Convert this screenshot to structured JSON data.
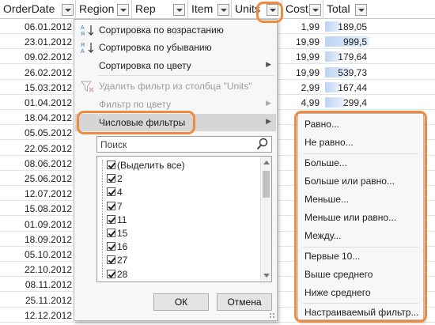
{
  "columns": [
    "OrderDate",
    "Region",
    "Rep",
    "Item",
    "Units",
    "Cost",
    "Total"
  ],
  "rows": [
    {
      "date": "06.01.2012",
      "cost": "1,99",
      "total": "189,05",
      "bar": 0.36
    },
    {
      "date": "23.01.2012",
      "cost": "19,99",
      "total": "999,5",
      "bar": 1.0
    },
    {
      "date": "09.02.2012",
      "cost": "19,99",
      "total": "179,64",
      "bar": 0.34
    },
    {
      "date": "26.02.2012",
      "cost": "19,99",
      "total": "539,73",
      "bar": 0.56
    },
    {
      "date": "15.03.2012",
      "cost": "2,99",
      "total": "167,44",
      "bar": 0.32
    },
    {
      "date": "01.04.2012",
      "cost": "4,99",
      "total": "299,4",
      "bar": 0.42
    },
    {
      "date": "18.04.2012",
      "cost": "",
      "total": "",
      "bar": 0
    },
    {
      "date": "05.05.2012",
      "cost": "",
      "total": "",
      "bar": 0
    },
    {
      "date": "22.05.2012",
      "cost": "",
      "total": "",
      "bar": 0
    },
    {
      "date": "08.06.2012",
      "cost": "",
      "total": "",
      "bar": 0
    },
    {
      "date": "25.06.2012",
      "cost": "",
      "total": "",
      "bar": 0
    },
    {
      "date": "12.07.2012",
      "cost": "",
      "total": "",
      "bar": 0
    },
    {
      "date": "15.08.2012",
      "cost": "",
      "total": "",
      "bar": 0
    },
    {
      "date": "01.09.2012",
      "cost": "",
      "total": "",
      "bar": 0
    },
    {
      "date": "18.09.2012",
      "cost": "",
      "total": "",
      "bar": 0
    },
    {
      "date": "05.10.2012",
      "cost": "",
      "total": "",
      "bar": 0
    },
    {
      "date": "22.10.2012",
      "cost": "",
      "total": "",
      "bar": 0
    },
    {
      "date": "08.11.2012",
      "cost": "",
      "total": "",
      "bar": 0
    },
    {
      "date": "25.11.2012",
      "cost": "",
      "total": "",
      "bar": 0
    },
    {
      "date": "12.12.2012",
      "cost": "",
      "total": "",
      "bar": 0
    }
  ],
  "menu": {
    "sort_asc": "Сортировка по возрастанию",
    "sort_desc": "Сортировка по убыванию",
    "sort_color": "Сортировка по цвету",
    "remove_filter": "Удалить фильтр из столбца \"Units\"",
    "filter_color": "Фильтр по цвету",
    "number_filters": "Числовые фильтры",
    "search_placeholder": "Поиск",
    "items": [
      "(Выделить все)",
      "2",
      "4",
      "7",
      "11",
      "15",
      "16",
      "27",
      "28"
    ],
    "ok": "ОК",
    "cancel": "Отмена"
  },
  "submenu": {
    "items": [
      "Равно...",
      "Не равно...",
      "Больше...",
      "Больше или равно...",
      "Меньше...",
      "Меньше или равно...",
      "Между...",
      "Первые 10...",
      "Выше среднего",
      "Ниже среднего",
      "Настраиваемый фильтр..."
    ]
  },
  "colors": {
    "accent": "#f08a3c",
    "databar": "#bcd3f3"
  }
}
